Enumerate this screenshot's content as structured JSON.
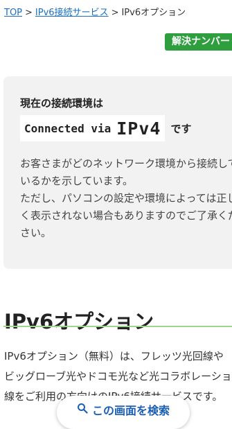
{
  "breadcrumb": {
    "items": [
      "TOP",
      "IPv6接続サービス",
      "IPv6オプション"
    ],
    "separator": ">"
  },
  "badge": {
    "label": "解決ナンバー"
  },
  "connection_status": {
    "heading": "現在の接続環境は",
    "connected_text": "Connected via",
    "protocol": "IPv4",
    "suffix": "です",
    "description": [
      "お客さまがどのネットワーク環境から接続して",
      "いるかを示しています。",
      "ただし、パソコンの設定や環境によっては正し",
      "く表示されない場合もありますのでご了承くだ",
      "さい。"
    ]
  },
  "section": {
    "title": "IPv6オプション",
    "body": [
      "IPv6オプション（無料）は、フレッツ光回線や",
      "ビッグローブ光やドコモ光など光コラボレーショ",
      "線をご利用の方向けのIPv6接続サービスです。"
    ]
  },
  "floating_button": {
    "label": "この画面を検索",
    "icon": "search-icon"
  },
  "colors": {
    "link": "#1a6fc1",
    "badge": "#2e9e3e",
    "rule": "#9fd38f",
    "box": "#f2f2f2"
  }
}
